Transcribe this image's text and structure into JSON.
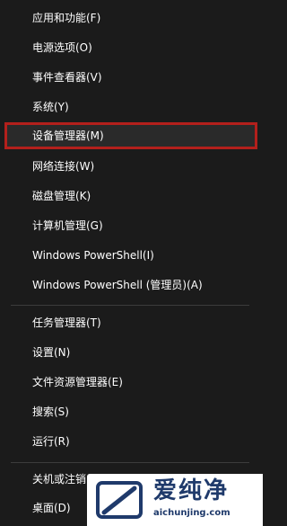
{
  "menu": {
    "group1": [
      {
        "label": "应用和功能(F)"
      },
      {
        "label": "电源选项(O)"
      },
      {
        "label": "事件查看器(V)"
      },
      {
        "label": "系统(Y)"
      },
      {
        "label": "设备管理器(M)"
      },
      {
        "label": "网络连接(W)"
      },
      {
        "label": "磁盘管理(K)"
      },
      {
        "label": "计算机管理(G)"
      },
      {
        "label": "Windows PowerShell(I)"
      },
      {
        "label": "Windows PowerShell (管理员)(A)"
      }
    ],
    "group2": [
      {
        "label": "任务管理器(T)"
      },
      {
        "label": "设置(N)"
      },
      {
        "label": "文件资源管理器(E)"
      },
      {
        "label": "搜索(S)"
      },
      {
        "label": "运行(R)"
      }
    ],
    "group3": [
      {
        "label": "关机或注销(U)"
      },
      {
        "label": "桌面(D)"
      }
    ],
    "selected_item": "设备管理器(M)"
  },
  "watermark": {
    "title": "爱纯净",
    "url": "aichunjing.com",
    "icon": "aichunjing-logo-icon"
  },
  "colors": {
    "background": "#1b1b1b",
    "text": "#ffffff",
    "highlight_border": "#b3201c",
    "divider": "#3c3c3c",
    "watermark_text": "#1f3a6b"
  }
}
